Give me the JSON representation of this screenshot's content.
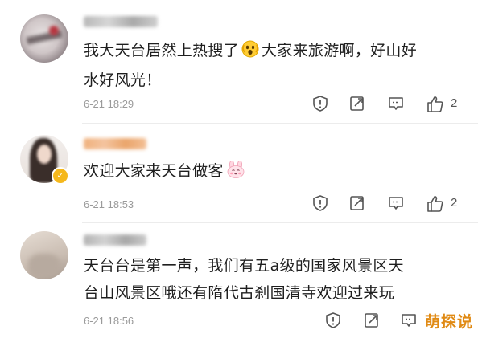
{
  "comments": [
    {
      "content_line1": "我大天台居然上热搜了",
      "emoji": "scared-face-emoji",
      "content_line1b": "大家来旅游啊，好山好",
      "content_line2": "水好风光！",
      "timestamp": "6-21 18:29",
      "likes": "2"
    },
    {
      "content_line1": "欢迎大家来天台做客",
      "emoji": "bunny-face-emoji",
      "timestamp": "6-21 18:53",
      "likes": "2"
    },
    {
      "content_line1": "天台台是第一声，我们有五a级的国家风景区天",
      "content_line2": "台山风景区哦还有隋代古刹国清寺欢迎过来玩",
      "timestamp": "6-21 18:56",
      "likes": ""
    }
  ],
  "watermark": "萌探说",
  "colors": {
    "verified_badge": "#f5b81c",
    "watermark": "#e08a14",
    "timestamp": "#9a9a9a"
  }
}
